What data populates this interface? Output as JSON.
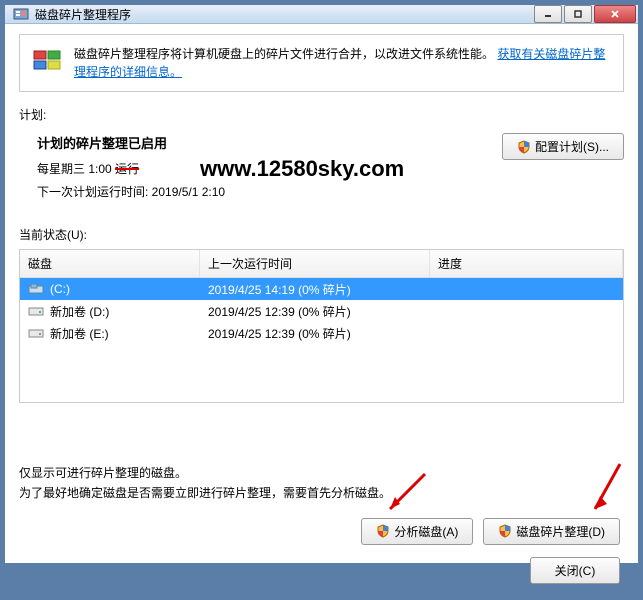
{
  "title": "磁盘碎片整理程序",
  "info": {
    "text": "磁盘碎片整理程序将计算机硬盘上的碎片文件进行合并，以改进文件系统性能。",
    "link": "获取有关磁盘碎片整理程序的详细信息。"
  },
  "schedule": {
    "label": "计划:",
    "title": "计划的碎片整理已启用",
    "freq_prefix": "每星期三 1:00 ",
    "freq_strike": "运行",
    "next": "下一次计划运行时间: 2019/5/1 2:10",
    "configure_btn": "配置计划(S)..."
  },
  "watermark": "www.12580sky.com",
  "status": {
    "label": "当前状态(U):",
    "headers": {
      "disk": "磁盘",
      "lastrun": "上一次运行时间",
      "progress": "进度"
    },
    "rows": [
      {
        "name": "(C:)",
        "lastrun": "2019/4/25 14:19 (0% 碎片)",
        "selected": true,
        "os": true
      },
      {
        "name": "新加卷 (D:)",
        "lastrun": "2019/4/25 12:39 (0% 碎片)",
        "selected": false,
        "os": false
      },
      {
        "name": "新加卷 (E:)",
        "lastrun": "2019/4/25 12:39 (0% 碎片)",
        "selected": false,
        "os": false
      }
    ]
  },
  "footer": {
    "line1": "仅显示可进行碎片整理的磁盘。",
    "line2": "为了最好地确定磁盘是否需要立即进行碎片整理，需要首先分析磁盘。"
  },
  "buttons": {
    "analyze": "分析磁盘(A)",
    "defrag": "磁盘碎片整理(D)",
    "close": "关闭(C)"
  }
}
